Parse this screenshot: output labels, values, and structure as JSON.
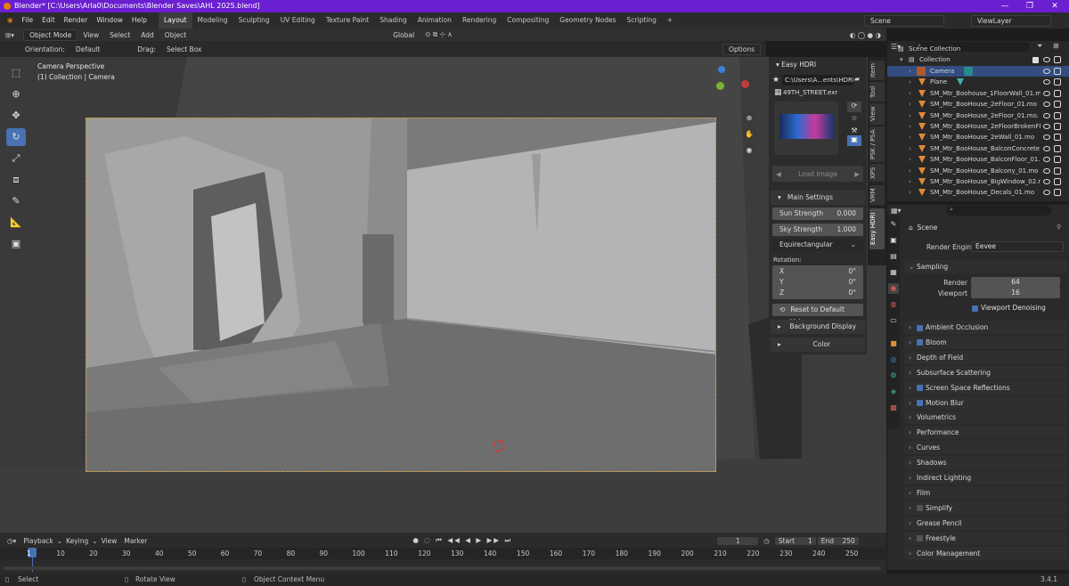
{
  "window": {
    "title": "Blender* [C:\\Users\\Arla0\\Documents\\Blender Saves\\AHL 2025.blend]",
    "controls": [
      "—",
      "❐",
      "✕"
    ]
  },
  "menu": [
    "File",
    "Edit",
    "Render",
    "Window",
    "Help"
  ],
  "workspaces": [
    "Layout",
    "Modeling",
    "Sculpting",
    "UV Editing",
    "Texture Paint",
    "Shading",
    "Animation",
    "Rendering",
    "Compositing",
    "Geometry Nodes",
    "Scripting",
    "+"
  ],
  "scene_name": "Scene",
  "view_layer": "ViewLayer",
  "header": {
    "mode": "Object Mode",
    "view": "View",
    "select": "Select",
    "add": "Add",
    "object": "Object",
    "transform": "Global",
    "options": "Options"
  },
  "header2": {
    "orientation_label": "Orientation:",
    "orientation_value": "Default",
    "drag_label": "Drag:",
    "drag_value": "Select Box"
  },
  "viewport": {
    "line1": "Camera Perspective",
    "line2": "(1) Collection | Camera"
  },
  "npanel": {
    "title": "Easy HDRI",
    "path": "C:\\Users\\A...ents\\HDRI\\",
    "file": "49TH_STREET.exr",
    "load_image": "Load Image",
    "main_settings": "Main Settings",
    "sun_label": "Sun Strength",
    "sun_value": "0.000",
    "sky_label": "Sky Strength",
    "sky_value": "1.000",
    "projection": "Equirectangular",
    "rotation": "Rotation:",
    "rot_x": "X",
    "rot_y": "Y",
    "rot_z": "Z",
    "rot_val": "0°",
    "reset": "Reset to Default Values",
    "bg_display": "Background Display",
    "color": "Color"
  },
  "side_tabs": [
    "Item",
    "Tool",
    "View",
    "PSK / PSA",
    "XPS",
    "VRM",
    "Easy HDRI"
  ],
  "outliner": {
    "root": "Scene Collection",
    "collection": "Collection",
    "items": [
      "Camera",
      "Plane",
      "SM_Mtr_Boohouse_1FloorWall_01.m",
      "SM_Mtr_BooHouse_2eFloor_01.mo",
      "SM_Mtr_BooHouse_2eFloor_01.mo.",
      "SM_Mtr_BooHouse_2eFloorBrokenFl",
      "SM_Mtr_BooHouse_2eWall_01.mo",
      "SM_Mtr_BooHouse_BalconConcrete",
      "SM_Mtr_BooHouse_BalconFloor_01.",
      "SM_Mtr_BooHouse_Balcony_01.mo",
      "SM_Mtr_BooHouse_BigWindow_02.r",
      "SM_Mtr_BooHouse_Decals_01.mo"
    ]
  },
  "properties": {
    "scene": "Scene",
    "render_engine_label": "Render Engine",
    "render_engine": "Eevee",
    "sampling": "Sampling",
    "render_label": "Render",
    "render_value": "64",
    "viewport_label": "Viewport",
    "viewport_value": "16",
    "denoise": "Viewport Denoising",
    "sections": [
      {
        "label": "Ambient Occlusion",
        "check": true
      },
      {
        "label": "Bloom",
        "check": true
      },
      {
        "label": "Depth of Field"
      },
      {
        "label": "Subsurface Scattering"
      },
      {
        "label": "Screen Space Reflections",
        "check": true
      },
      {
        "label": "Motion Blur",
        "check": true
      },
      {
        "label": "Volumetrics"
      },
      {
        "label": "Performance"
      },
      {
        "label": "Curves"
      },
      {
        "label": "Shadows"
      },
      {
        "label": "Indirect Lighting"
      },
      {
        "label": "Film"
      },
      {
        "label": "Simplify",
        "check": false
      },
      {
        "label": "Grease Pencil"
      },
      {
        "label": "Freestyle",
        "check": false
      },
      {
        "label": "Color Management"
      }
    ]
  },
  "timeline": {
    "playback": "Playback",
    "keying": "Keying",
    "view": "View",
    "marker": "Marker",
    "current": "1",
    "start_label": "Start",
    "start": "1",
    "end_label": "End",
    "end": "250",
    "ticks": [
      "1",
      "10",
      "20",
      "30",
      "40",
      "50",
      "60",
      "70",
      "80",
      "90",
      "100",
      "110",
      "120",
      "130",
      "140",
      "150",
      "160",
      "170",
      "180",
      "190",
      "200",
      "210",
      "220",
      "230",
      "240",
      "250"
    ]
  },
  "status": {
    "select": "Select",
    "rotate": "Rotate View",
    "context": "Object Context Menu",
    "version": "3.4.1"
  },
  "colors": {
    "title_bar": "#6a1fd0",
    "active": "#4772b3",
    "camera_frame": "#d49a3c",
    "object_icon": "#e08a35"
  }
}
